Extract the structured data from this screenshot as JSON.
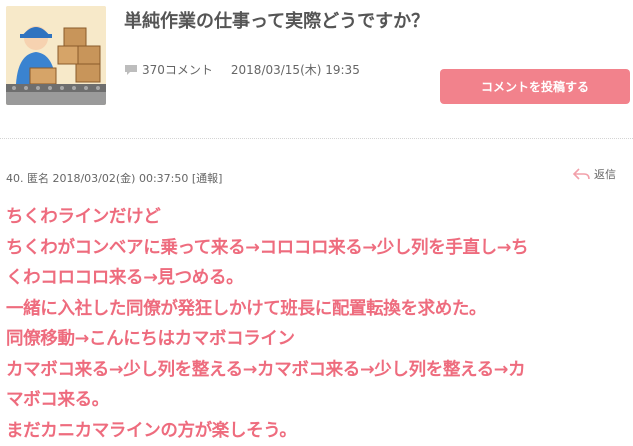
{
  "thread": {
    "title": "単純作業の仕事って実際どうですか？",
    "comment_count": "370コメント",
    "posted_at": "2018/03/15(木) 19:35",
    "post_button_label": "コメントを投稿する",
    "thumbnail_icon": "factory-worker-illustration"
  },
  "comment": {
    "header": "40. 匿名 2018/03/02(金) 00:37:50 [通報]",
    "reply_label": "返信",
    "lines": [
      "ちくわラインだけど",
      "ちくわがコンベアに乗って来る→コロコロ来る→少し列を手直し→ち",
      "くわコロコロ来る→見つめる。",
      "一緒に入社した同僚が発狂しかけて班長に配置転換を求めた。",
      "同僚移動→こんにちはカマボコライン",
      "カマボコ来る→少し列を整える→カマボコ来る→少し列を整える→カ",
      "マボコ来る。",
      "まだカニカマラインの方が楽しそう。"
    ]
  },
  "colors": {
    "accent": "#f2828c",
    "comment_text": "#ee6c7e",
    "meta_text": "#666666"
  }
}
